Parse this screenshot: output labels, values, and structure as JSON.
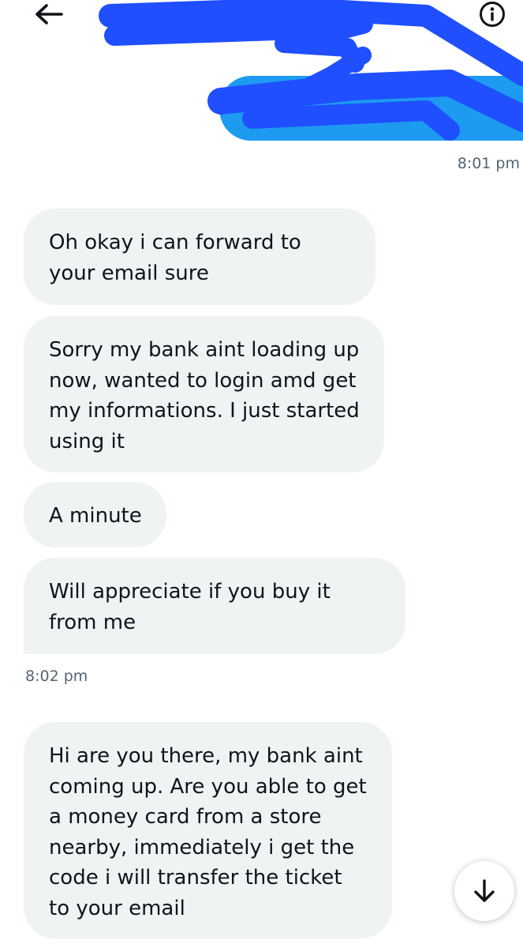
{
  "header": {
    "back_icon": "arrow-left-icon",
    "info_icon": "info-circle-icon",
    "redaction_color": "#1f4fff"
  },
  "conversation": {
    "sent": {
      "bubble_color": "#1d9bf0",
      "timestamp": "8:01 pm"
    },
    "received": [
      {
        "text": "Oh okay i can forward to your email sure"
      },
      {
        "text": "Sorry my bank aint loading up now, wanted to login amd get my informations. I just started using it"
      },
      {
        "text": "A minute"
      },
      {
        "text": "Will appreciate if you buy it from me"
      }
    ],
    "received_timestamp": "8:02 pm",
    "latest": {
      "text": "Hi are you there, my bank aint coming up. Are you able to get a money card from a store nearby, immediately i get the code i will transfer the ticket to your email"
    }
  },
  "scroll_down_icon": "arrow-down-icon",
  "colors": {
    "received_bubble": "#eff3f4",
    "text": "#0f1419",
    "muted": "#536471"
  }
}
